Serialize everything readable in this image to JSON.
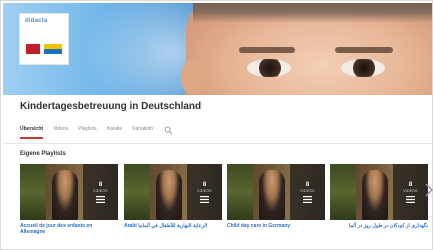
{
  "channel": {
    "logo_text": "didacta",
    "name": "Kindertagesbetreuung in Deutschland"
  },
  "tabs": [
    {
      "label": "Übersicht",
      "active": true
    },
    {
      "label": "Videos",
      "active": false
    },
    {
      "label": "Playlists",
      "active": false
    },
    {
      "label": "Kanäle",
      "active": false
    },
    {
      "label": "Kanalinfo",
      "active": false
    }
  ],
  "section": {
    "title": "Eigene Playlists"
  },
  "playlists": [
    {
      "title": "Accueil de jour des enfants en Allemagne",
      "count": "8",
      "count_label": "VIDEOS",
      "dir": "ltr"
    },
    {
      "title": "Arabi الرعاية النهارية للأطفال في ألمانيا",
      "count": "8",
      "count_label": "VIDEOS",
      "dir": "rtl"
    },
    {
      "title": "Child day care in Germany",
      "count": "8",
      "count_label": "VIDEOS",
      "dir": "ltr"
    },
    {
      "title": "نگهداری از کودکان در طول روز در آلما",
      "count": "8",
      "count_label": "VIDEOS",
      "dir": "rtl"
    }
  ],
  "icons": {
    "search": "search-icon",
    "playlist": "playlist-icon",
    "next": "chevron-right-icon"
  },
  "colors": {
    "tab_underline": "#c03a3a",
    "link": "#2a6fc4",
    "banner_sky": "#4d98d6"
  }
}
